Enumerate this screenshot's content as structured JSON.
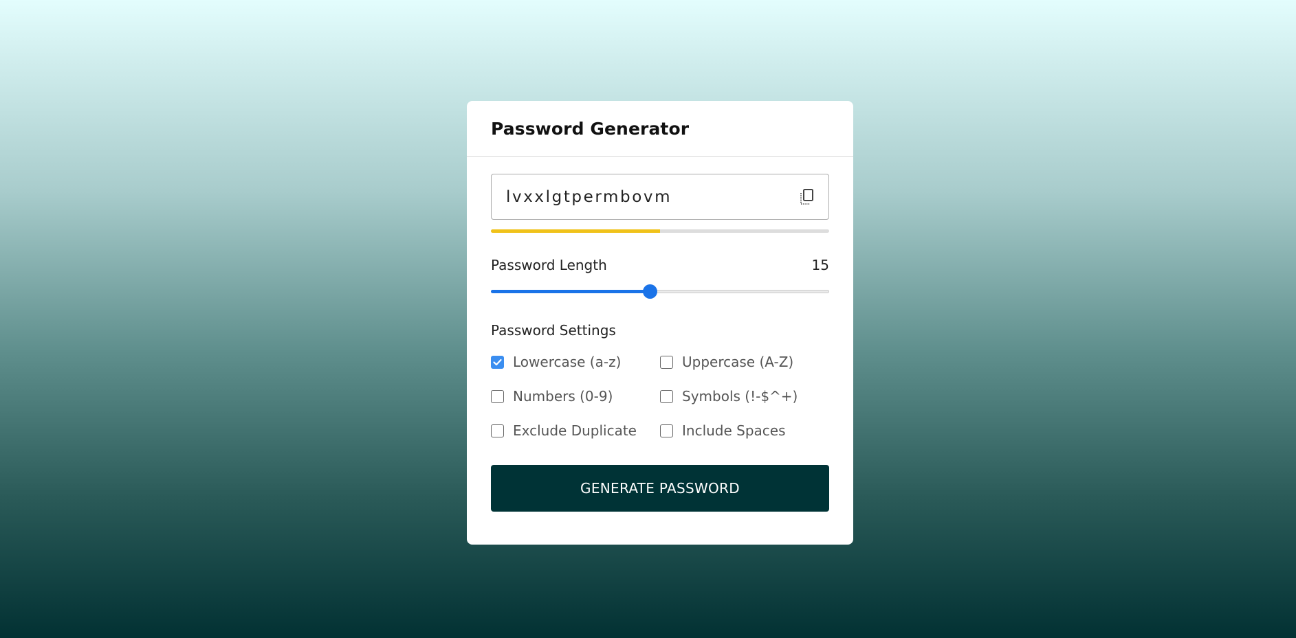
{
  "card": {
    "title": "Password Generator"
  },
  "password": {
    "value": "lvxxlgtpermbovm",
    "strength_fraction": 0.5
  },
  "length": {
    "label": "Password Length",
    "value": "15",
    "slider_fraction": 0.47
  },
  "settings": {
    "title": "Password Settings",
    "options": [
      {
        "label": "Lowercase (a-z)",
        "checked": true
      },
      {
        "label": "Uppercase (A-Z)",
        "checked": false
      },
      {
        "label": "Numbers (0-9)",
        "checked": false
      },
      {
        "label": "Symbols (!-$^+)",
        "checked": false
      },
      {
        "label": "Exclude Duplicate",
        "checked": false
      },
      {
        "label": "Include Spaces",
        "checked": false
      }
    ]
  },
  "button": {
    "label": "GENERATE PASSWORD"
  },
  "colors": {
    "accent": "#1a73e8",
    "strength": "#f0c21a",
    "button": "#003336",
    "checkbox": "#3b8ef0"
  },
  "icons": {
    "copy": "copy-icon",
    "check": "check-icon"
  }
}
